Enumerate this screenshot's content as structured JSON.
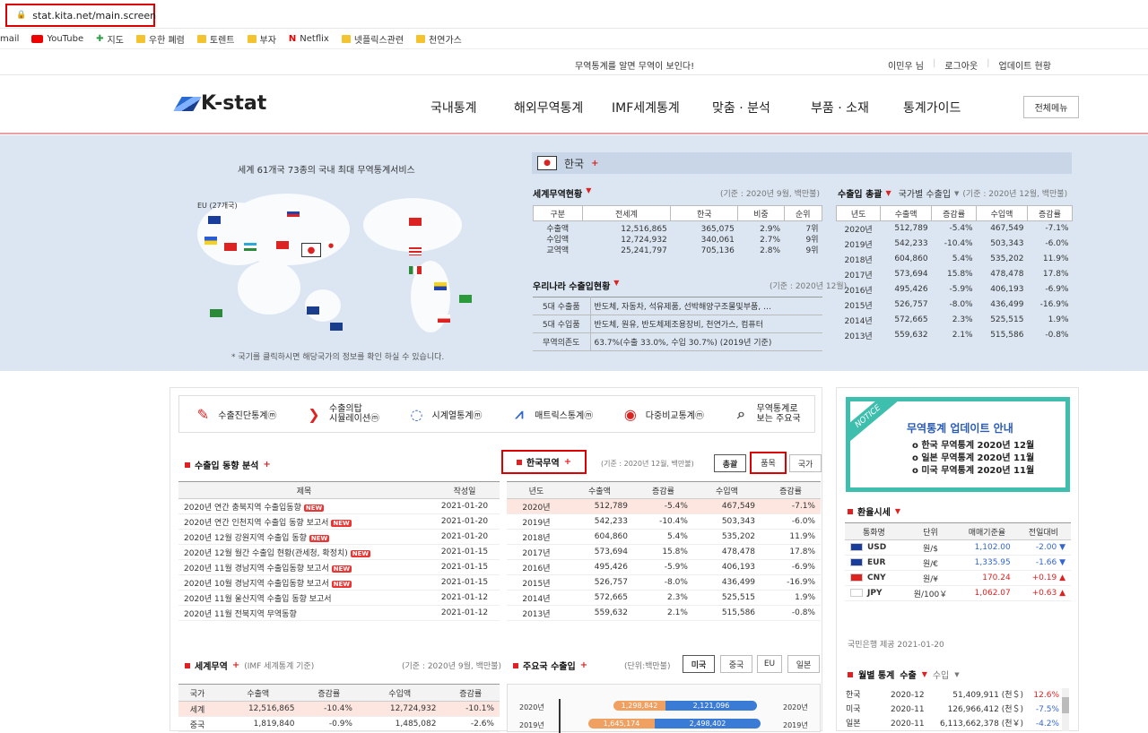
{
  "browser": {
    "url": "stat.kita.net/main.screen",
    "bookmarks": [
      "mail",
      "YouTube",
      "지도",
      "우한 폐렴",
      "토렌트",
      "부자",
      "Netflix",
      "넷플릭스관련",
      "천연가스"
    ]
  },
  "top": {
    "slogan": "무역통계를 알면 무역이 보인다!",
    "user": "이민우 님",
    "logout": "로그아웃",
    "update": "업데이트 현황"
  },
  "header": {
    "logo": "K-stat",
    "nav": [
      "국내통계",
      "해외무역통계",
      "IMF세계통계",
      "맞춤 · 분석",
      "부품 · 소재",
      "통계가이드"
    ],
    "allmenu": "전체메뉴"
  },
  "hero": {
    "title": "세계 61개국 73종의 국내 최대 무역통계서비스",
    "eu": "EU (27개국)",
    "note": "* 국기를 클릭하시면 해당국가의 정보를 확인 하실 수 있습니다.",
    "country": "한국",
    "world_trade": {
      "title": "세계무역현황",
      "basis": "(기준 : 2020년 9월, 백만불)",
      "headers": [
        "구분",
        "전세계",
        "한국",
        "비중",
        "순위"
      ],
      "rows": [
        [
          "수출액",
          "12,516,865",
          "365,075",
          "2.9%",
          "7위"
        ],
        [
          "수입액",
          "12,724,932",
          "340,061",
          "2.7%",
          "9위"
        ],
        [
          "교역액",
          "25,241,797",
          "705,136",
          "2.8%",
          "9위"
        ]
      ]
    },
    "korea_trade": {
      "title": "우리나라 수출입현황",
      "basis": "(기준 : 2020년 12월)",
      "rows": [
        [
          "5대 수출품",
          "반도체, 자동차, 석유제품, 선박해양구조물및부품, …"
        ],
        [
          "5대 수입품",
          "반도체, 원유, 반도체제조용장비, 천연가스, 컴퓨터"
        ],
        [
          "무역의존도",
          "63.7%(수출 33.0%, 수입 30.7%) (2019년 기준)"
        ]
      ]
    },
    "total": {
      "title1": "수출입 총괄",
      "title2": "국가별 수출입",
      "basis": "(기준 : 2020년 12월, 백만불)",
      "headers": [
        "년도",
        "수출액",
        "증감률",
        "수입액",
        "증감률"
      ],
      "rows": [
        [
          "2020년",
          "512,789",
          "-5.4%",
          "467,549",
          "-7.1%"
        ],
        [
          "2019년",
          "542,233",
          "-10.4%",
          "503,343",
          "-6.0%"
        ],
        [
          "2018년",
          "604,860",
          "5.4%",
          "535,202",
          "11.9%"
        ],
        [
          "2017년",
          "573,694",
          "15.8%",
          "478,478",
          "17.8%"
        ],
        [
          "2016년",
          "495,426",
          "-5.9%",
          "406,193",
          "-6.9%"
        ],
        [
          "2015년",
          "526,757",
          "-8.0%",
          "436,499",
          "-16.9%"
        ],
        [
          "2014년",
          "572,665",
          "2.3%",
          "525,515",
          "1.9%"
        ],
        [
          "2013년",
          "559,632",
          "2.1%",
          "515,586",
          "-0.8%"
        ]
      ]
    }
  },
  "quick": [
    {
      "icon": "edit-icon",
      "label": "수출진단통계ⓜ"
    },
    {
      "icon": "flame-icon",
      "label": "수출의탑\n시뮬레이션ⓜ"
    },
    {
      "icon": "clock-icon",
      "label": "시계열통계ⓜ"
    },
    {
      "icon": "chart-icon",
      "label": "매트릭스통계ⓜ"
    },
    {
      "icon": "compare-icon",
      "label": "다중비교통계ⓜ"
    },
    {
      "icon": "search-icon",
      "label": "무역통계로\n보는 주요국"
    }
  ],
  "analysis": {
    "title": "수출입 동향 분석",
    "headers": [
      "제목",
      "작성일"
    ],
    "rows": [
      [
        "2020년 연간 충북지역 수출입동향",
        "2021-01-20",
        true
      ],
      [
        "2020년 연간 인천지역 수출입 동향 보고서",
        "2021-01-20",
        true
      ],
      [
        "2020년 12월 강원지역 수출입 동향",
        "2021-01-20",
        true
      ],
      [
        "2020년 12월 월간 수출입 현황(관세청, 확정치)",
        "2021-01-15",
        true
      ],
      [
        "2020년 11월 경남지역 수출입동향 보고서",
        "2021-01-15",
        true
      ],
      [
        "2020년 10월 경남지역 수출입동향 보고서",
        "2021-01-15",
        true
      ],
      [
        "2020년 11월 울산지역 수출입 동향 보고서",
        "2021-01-12",
        false
      ],
      [
        "2020년 11월 전북지역 무역동향",
        "2021-01-12",
        false
      ]
    ],
    "new": "NEW"
  },
  "korea_trade2": {
    "title": "한국무역",
    "basis": "(기준 : 2020년 12월, 백만불)",
    "tabs": [
      "총괄",
      "품목",
      "국가"
    ],
    "headers": [
      "년도",
      "수출액",
      "증감률",
      "수입액",
      "증감률"
    ]
  },
  "world_trade2": {
    "title": "세계무역",
    "sub": "(IMF 세계통계 기준)",
    "basis": "(기준 : 2020년 9월, 백만불)",
    "headers": [
      "국가",
      "수출액",
      "증감률",
      "수입액",
      "증감률"
    ],
    "rows": [
      [
        "세계",
        "12,516,865",
        "-10.4%",
        "12,724,932",
        "-10.1%"
      ],
      [
        "중국",
        "1,819,840",
        "-0.9%",
        "1,485,082",
        "-2.6%"
      ]
    ]
  },
  "major": {
    "title": "주요국 수출입",
    "unit": "(단위:백만불)",
    "tabs": [
      "미국",
      "중국",
      "EU",
      "일본"
    ],
    "bars": [
      {
        "year": "2020년",
        "export": "1,298,842",
        "import": "2,121,096"
      },
      {
        "year": "2019년",
        "export": "1,645,174",
        "import": "2,498,402"
      }
    ]
  },
  "notice": {
    "badge": "NOTICE",
    "title": "무역통계 업데이트 안내",
    "items": [
      "o 한국 무역통계 2020년 12월",
      "o 일본 무역통계 2020년 11월",
      "o 미국 무역통계 2020년 11월"
    ]
  },
  "fx": {
    "title": "환율시세",
    "headers": [
      "통화명",
      "단위",
      "매매기준율",
      "전일대비"
    ],
    "rows": [
      [
        "USD",
        "원/$",
        "1,102.00",
        "-2.00"
      ],
      [
        "EUR",
        "원/€",
        "1,335.95",
        "-1.66"
      ],
      [
        "CNY",
        "원/¥",
        "170.24",
        "+0.19"
      ],
      [
        "JPY",
        "원/100￥",
        "1,062.07",
        "+0.63"
      ]
    ],
    "source": "국민은행 제공 2021-01-20"
  },
  "monthly": {
    "title": "월별 통계",
    "tab_export": "수출",
    "tab_import": "수입",
    "rows": [
      [
        "한국",
        "2020-12",
        "51,409,911 (천＄)",
        "12.6%"
      ],
      [
        "미국",
        "2020-11",
        "126,966,412 (천＄)",
        "-7.5%"
      ],
      [
        "일본",
        "2020-11",
        "6,113,662,378 (천￥)",
        "-4.2%"
      ]
    ]
  }
}
